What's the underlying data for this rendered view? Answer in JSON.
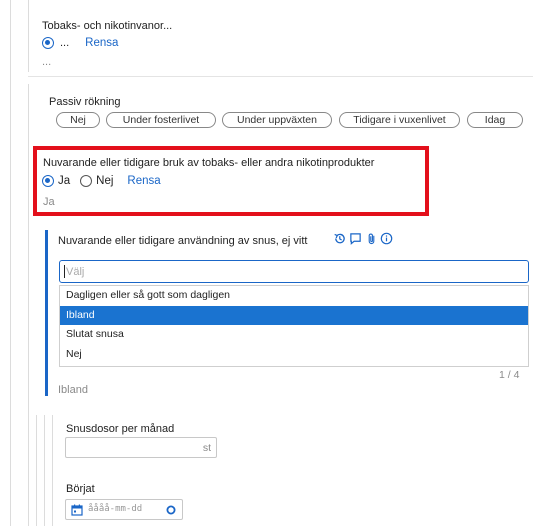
{
  "tobak": {
    "title": "Tobaks- och nikotinvanor...",
    "option_label": "...",
    "clear": "Rensa",
    "summary": "..."
  },
  "passiv": {
    "title": "Passiv rökning",
    "options": [
      "Nej",
      "Under fosterlivet",
      "Under uppväxten",
      "Tidigare i vuxenlivet",
      "Idag"
    ]
  },
  "bruk": {
    "title": "Nuvarande eller tidigare bruk av tobaks- eller andra nikotinprodukter",
    "opt_yes": "Ja",
    "opt_no": "Nej",
    "clear": "Rensa",
    "summary": "Ja"
  },
  "snus": {
    "title": "Nuvarande eller tidigare användning av snus, ej vitt",
    "placeholder": "Välj",
    "options": [
      "Dagligen eller så gott som dagligen",
      "Ibland",
      "Slutat snusa",
      "Nej"
    ],
    "selected_index": 1,
    "counter": "1 / 4",
    "summary": "Ibland"
  },
  "dos": {
    "title": "Snusdosor per månad",
    "unit": "st"
  },
  "borjat": {
    "title": "Börjat",
    "placeholder": "åååå-mm-dd"
  },
  "colors": {
    "accent": "#1a66c7",
    "highlight": "#e3101b",
    "selected_option": "#1a73d0"
  }
}
